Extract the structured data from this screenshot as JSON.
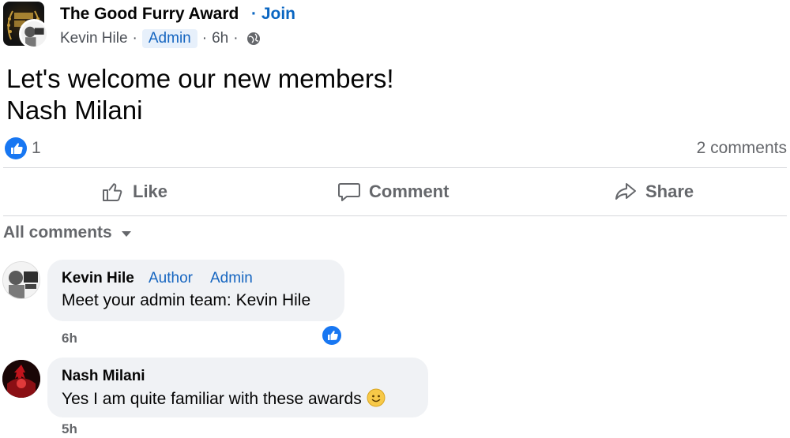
{
  "post": {
    "group_name": "The Good Furry Award",
    "dot": "·",
    "join_label": "Join",
    "author": "Kevin Hile",
    "author_role": "Admin",
    "time": "6h",
    "line1": "Let's welcome our new members!",
    "line2": "Nash Milani"
  },
  "stats": {
    "likes": "1",
    "comments": "2 comments"
  },
  "actions": {
    "like": "Like",
    "comment": "Comment",
    "share": "Share"
  },
  "comments_filter": "All comments",
  "comments": [
    {
      "author": "Kevin Hile",
      "badges": [
        "Author",
        "Admin"
      ],
      "text": "Meet your admin team: Kevin Hile",
      "time": "6h",
      "liked": true
    },
    {
      "author": "Nash Milani",
      "badges": [],
      "text": "Yes I am quite familiar with these awards",
      "emoji": "slightly-smiling-face",
      "time": "5h",
      "liked": false
    }
  ],
  "colors": {
    "accent": "#1877f2",
    "link": "#0a66c2",
    "muted": "#65676b",
    "bubble": "#f0f2f5"
  },
  "icons": [
    "globe-icon",
    "like-icon",
    "comment-icon",
    "share-icon",
    "caret-down-icon",
    "smiley-emoji-icon"
  ]
}
